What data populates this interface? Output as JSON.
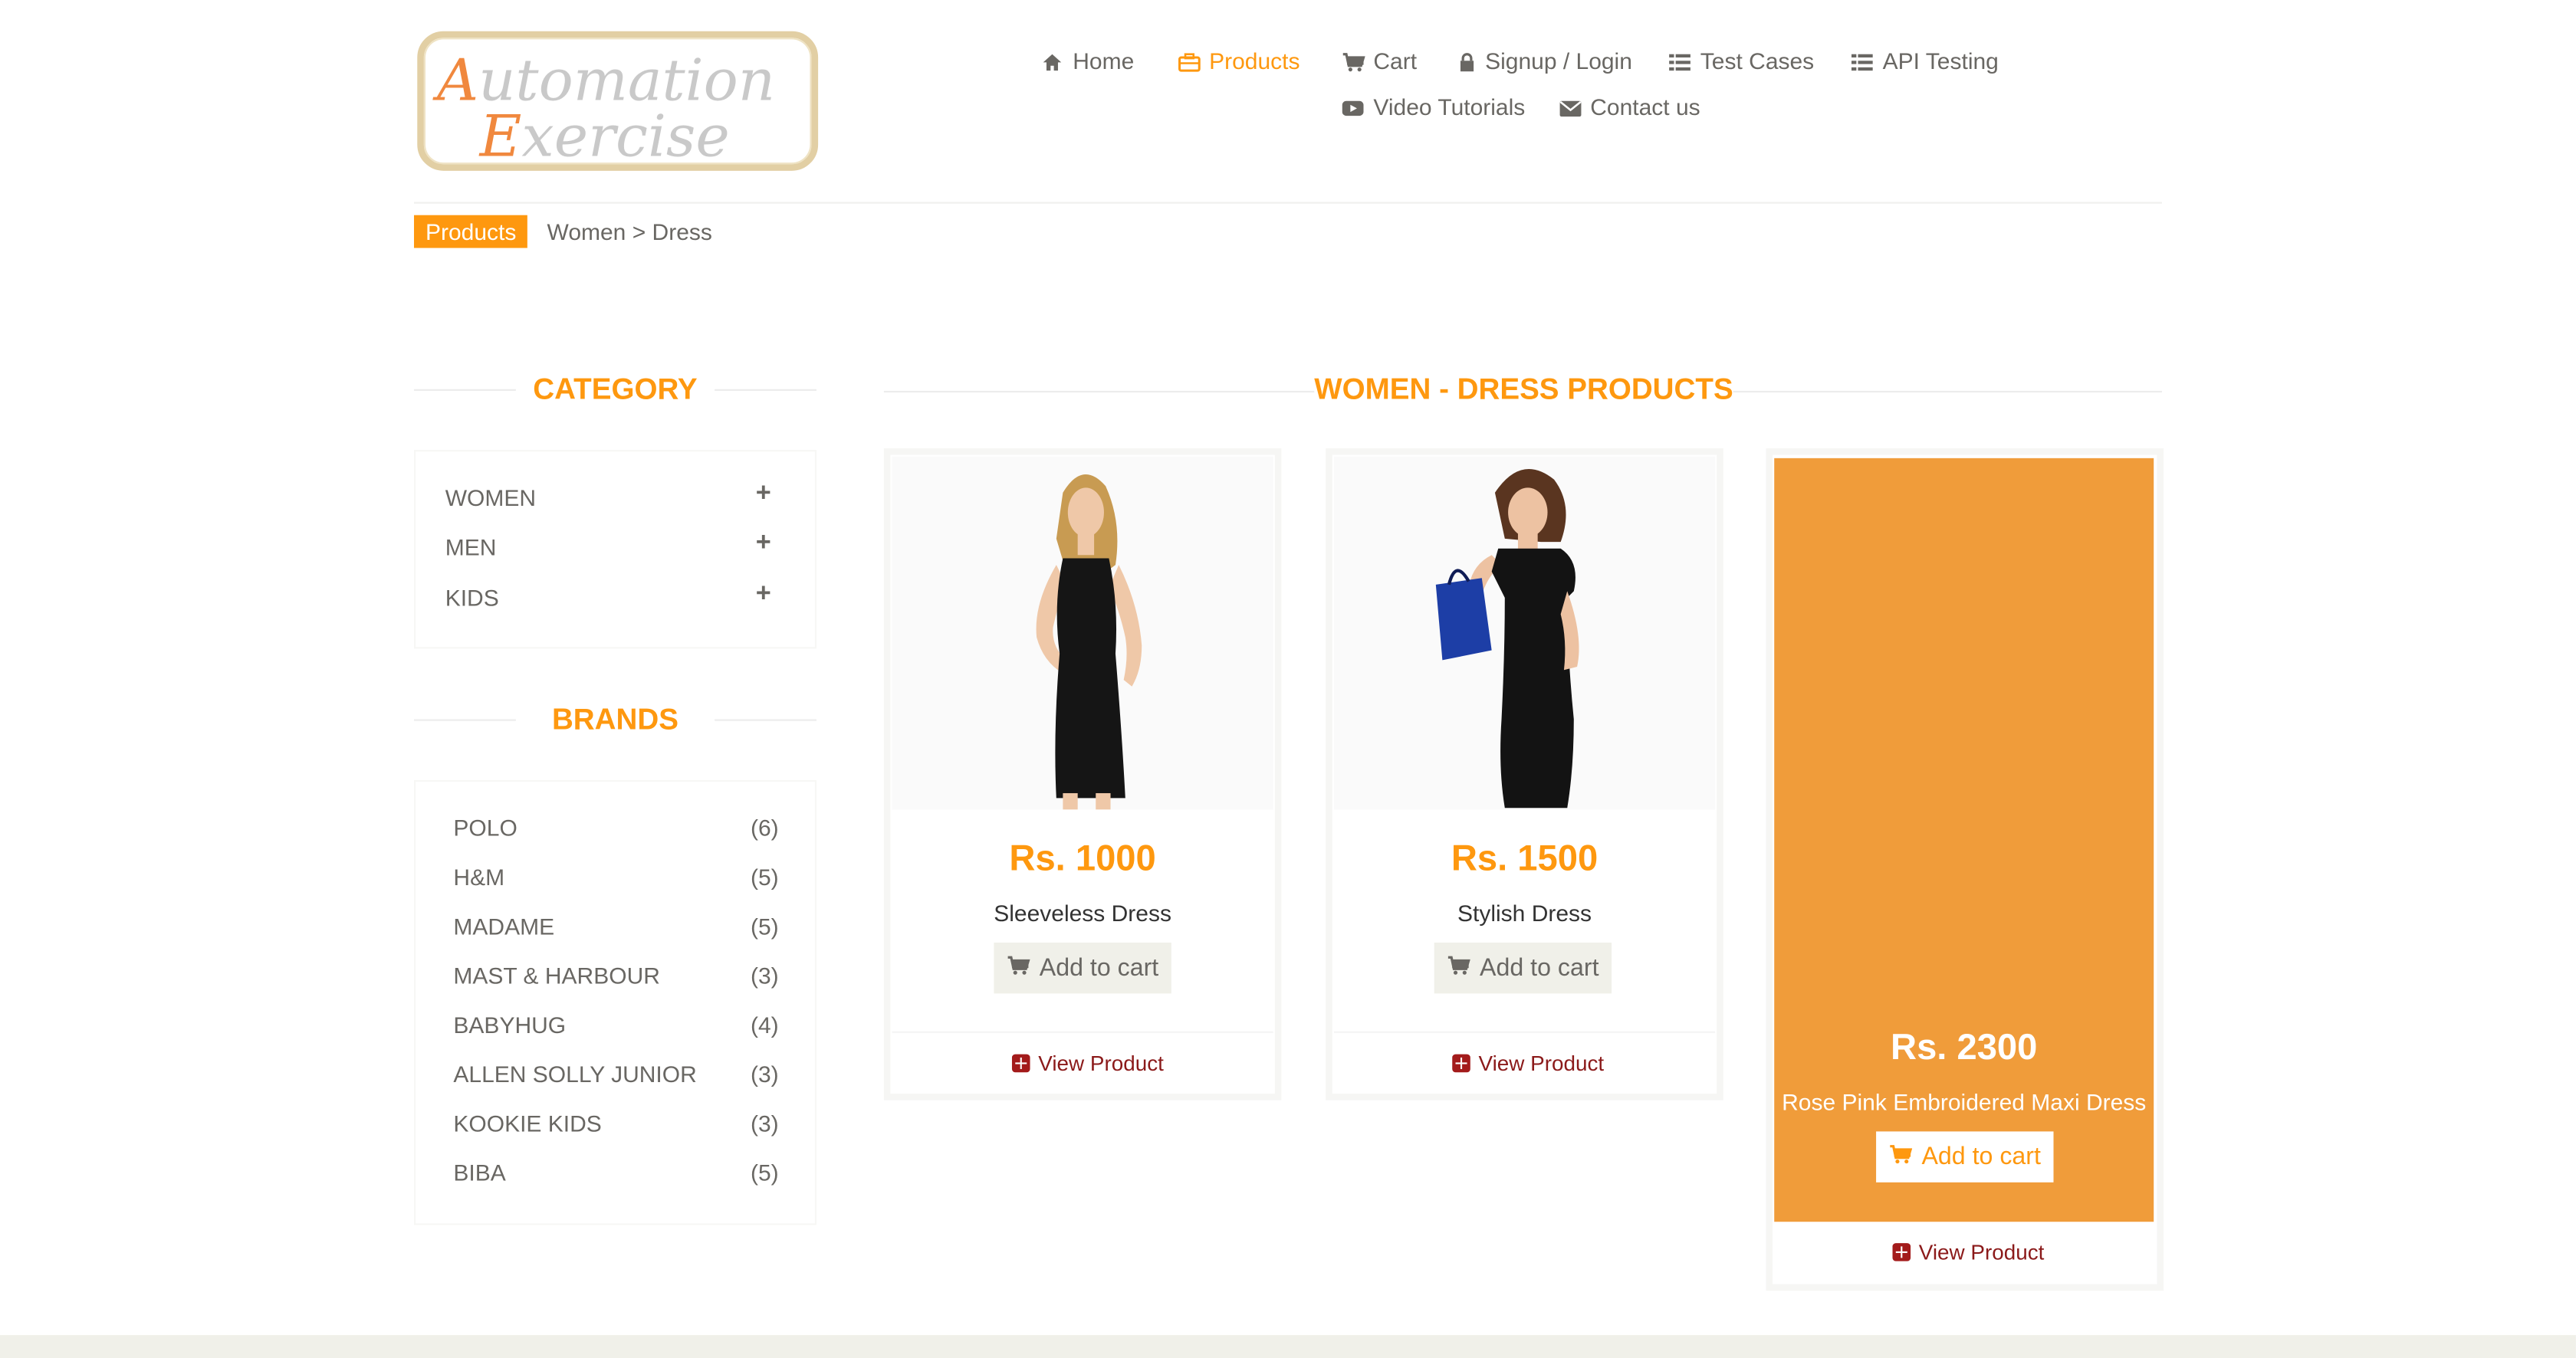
{
  "logo": {
    "line1": "Automation",
    "line2": "Exercise"
  },
  "nav": {
    "home": "Home",
    "products": "Products",
    "cart": "Cart",
    "signup": "Signup / Login",
    "test_cases": "Test Cases",
    "api_testing": "API Testing",
    "video_tutorials": "Video Tutorials",
    "contact": "Contact us"
  },
  "breadcrumb": {
    "active": "Products",
    "rest": "Women > Dress"
  },
  "sidebar": {
    "category_title": "CATEGORY",
    "categories": [
      "WOMEN",
      "MEN",
      "KIDS"
    ],
    "brands_title": "BRANDS",
    "brands": [
      {
        "name": "POLO",
        "count": "(6)"
      },
      {
        "name": "H&M",
        "count": "(5)"
      },
      {
        "name": "MADAME",
        "count": "(5)"
      },
      {
        "name": "MAST & HARBOUR",
        "count": "(3)"
      },
      {
        "name": "BABYHUG",
        "count": "(4)"
      },
      {
        "name": "ALLEN SOLLY JUNIOR",
        "count": "(3)"
      },
      {
        "name": "KOOKIE KIDS",
        "count": "(3)"
      },
      {
        "name": "BIBA",
        "count": "(5)"
      }
    ]
  },
  "main": {
    "title": "WOMEN - DRESS PRODUCTS",
    "products": [
      {
        "price": "Rs. 1000",
        "name": "Sleeveless Dress",
        "add_label": "Add to cart",
        "view_label": "View Product"
      },
      {
        "price": "Rs. 1500",
        "name": "Stylish Dress",
        "add_label": "Add to cart",
        "view_label": "View Product"
      },
      {
        "price": "Rs. 2300",
        "name": "Rose Pink Embroidered Maxi Dress",
        "add_label": "Add to cart",
        "view_label": "View Product"
      }
    ]
  },
  "colors": {
    "accent": "#fe980f",
    "text": "#696763",
    "view_link": "#8b1a1a"
  }
}
